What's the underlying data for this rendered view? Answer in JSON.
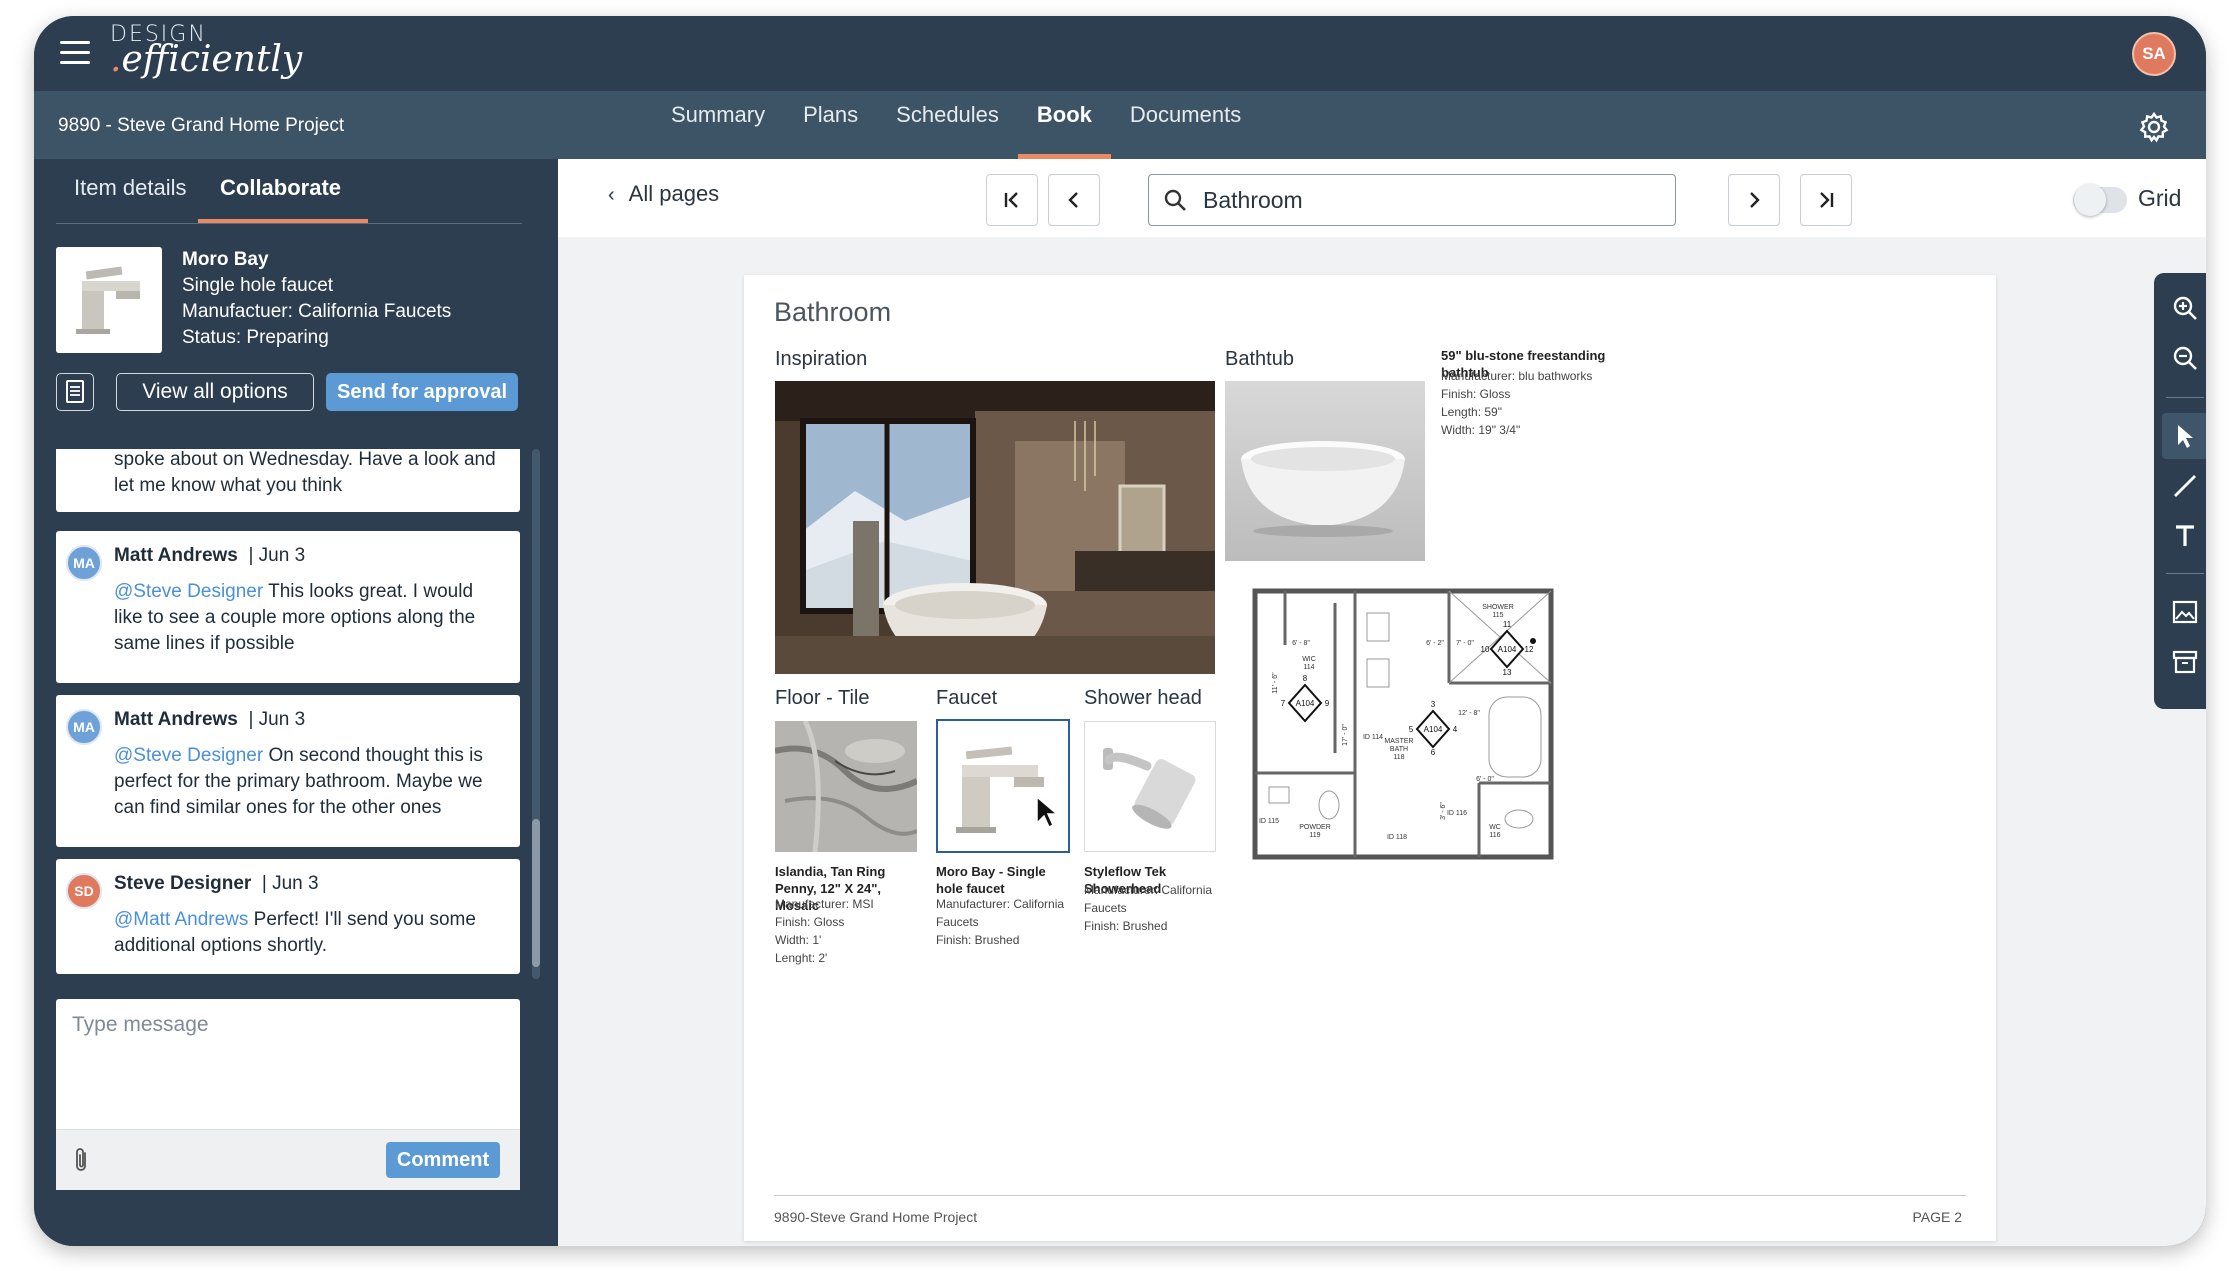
{
  "app": {
    "logo_line1": "DESIGN",
    "logo_line2_dot": ".",
    "logo_line2": "efficiently",
    "user_initials": "SA"
  },
  "nav": {
    "project_name": "9890 - Steve Grand Home Project",
    "tabs": [
      {
        "label": "Summary"
      },
      {
        "label": "Plans"
      },
      {
        "label": "Schedules"
      },
      {
        "label": "Book"
      },
      {
        "label": "Documents"
      }
    ]
  },
  "panel": {
    "tabs": [
      {
        "label": "Item details"
      },
      {
        "label": "Collaborate"
      }
    ],
    "item": {
      "name": "Moro Bay",
      "type": "Single hole faucet",
      "manufacturer": "Manufactuer: California Faucets",
      "status": "Status: Preparing"
    },
    "view_all_label": "View all options",
    "approval_label": "Send for approval",
    "comments": [
      {
        "text": "spoke about on Wednesday. Have a look and let me know what you think"
      },
      {
        "initials": "MA",
        "author": "Matt Andrews",
        "date": "| Jun 3",
        "mention": "@Steve Designer",
        "text": " This looks great. I would like to see a couple more options along the same lines if possible"
      },
      {
        "initials": "MA",
        "author": "Matt Andrews",
        "date": "| Jun 3",
        "mention": "@Steve Designer",
        "text": " On second thought this is perfect for the primary bathroom. Maybe we can find similar ones for the other ones"
      },
      {
        "initials": "SD",
        "author": "Steve Designer",
        "date": "| Jun 3",
        "mention": "@Matt Andrews",
        "text": " Perfect! I'll send you some additional options shortly."
      }
    ],
    "message_placeholder": "Type message",
    "comment_label": "Comment"
  },
  "pagebar": {
    "all_pages_label": "All pages",
    "search_value": "Bathroom",
    "grid_label": "Grid",
    "grid_on": false
  },
  "page": {
    "title": "Bathroom",
    "inspiration_label": "Inspiration",
    "bathtub_label": "Bathtub",
    "bathtub": {
      "title": "59\" blu-stone freestanding bathtub",
      "lines": [
        "Manufacturer: blu bathworks",
        "Finish: Gloss",
        "Length: 59\"",
        "Width: 19\" 3/4\""
      ]
    },
    "floor_label": "Floor - Tile",
    "floor": {
      "title": "Islandia, Tan Ring Penny, 12\" X 24\", Mosaic",
      "lines": [
        "Manufacturer: MSI",
        "Finish: Gloss",
        "Width: 1'",
        "Lenght: 2'"
      ]
    },
    "faucet_label": "Faucet",
    "faucet": {
      "title": "Moro Bay - Single hole faucet",
      "lines": [
        "Manufacturer: California Faucets",
        "Finish: Brushed"
      ]
    },
    "shower_label": "Shower head",
    "shower": {
      "title": "Styleflow Tek Showerhead",
      "lines": [
        "Manufacturer: California Faucets",
        "Finish: Brushed"
      ]
    },
    "plan": {
      "shower": "SHOWER",
      "shower_num": "115",
      "wic": "WIC",
      "wic_num": "114",
      "master": "MASTER",
      "bath": "BATH",
      "bath_num": "118",
      "powder": "POWDER",
      "powder_num": "119",
      "wc": "WC",
      "wc_num": "116",
      "tag": "A104",
      "dim1": "6' - 8\"",
      "dim2": "6' - 2\"",
      "dim3": "7' - 0\"",
      "dim4": "12' - 8\"",
      "dim5": "6' - 0\"",
      "dim6": "11' - 6\"",
      "dim7": "17' - 0\"",
      "dim8": "3' - 6\"",
      "num3": "3",
      "num4": "4",
      "num5": "5",
      "num6": "6",
      "num7": "7",
      "num8": "8",
      "num9": "9",
      "num10": "10",
      "num11": "11",
      "num12": "12",
      "num13": "13",
      "id114": "ID 114",
      "id115": "ID 115",
      "id116": "ID 116",
      "id118": "ID 118"
    },
    "footer_left": "9890-Steve Grand Home Project",
    "footer_right": "PAGE 2"
  },
  "colors": {
    "header": "#2c3e50",
    "navbar": "#3d5366",
    "accent": "#e98a64",
    "button_blue": "#5c9ad6",
    "mention": "#4a90d9"
  },
  "icons": [
    "menu-icon",
    "gear-icon",
    "document-icon",
    "paperclip-icon",
    "chevron-left-icon",
    "first-page-icon",
    "prev-page-icon",
    "next-page-icon",
    "last-page-icon",
    "search-icon",
    "zoom-in-icon",
    "zoom-out-icon",
    "pointer-icon",
    "line-icon",
    "text-icon",
    "image-icon",
    "archive-icon",
    "mouse-cursor-icon"
  ]
}
